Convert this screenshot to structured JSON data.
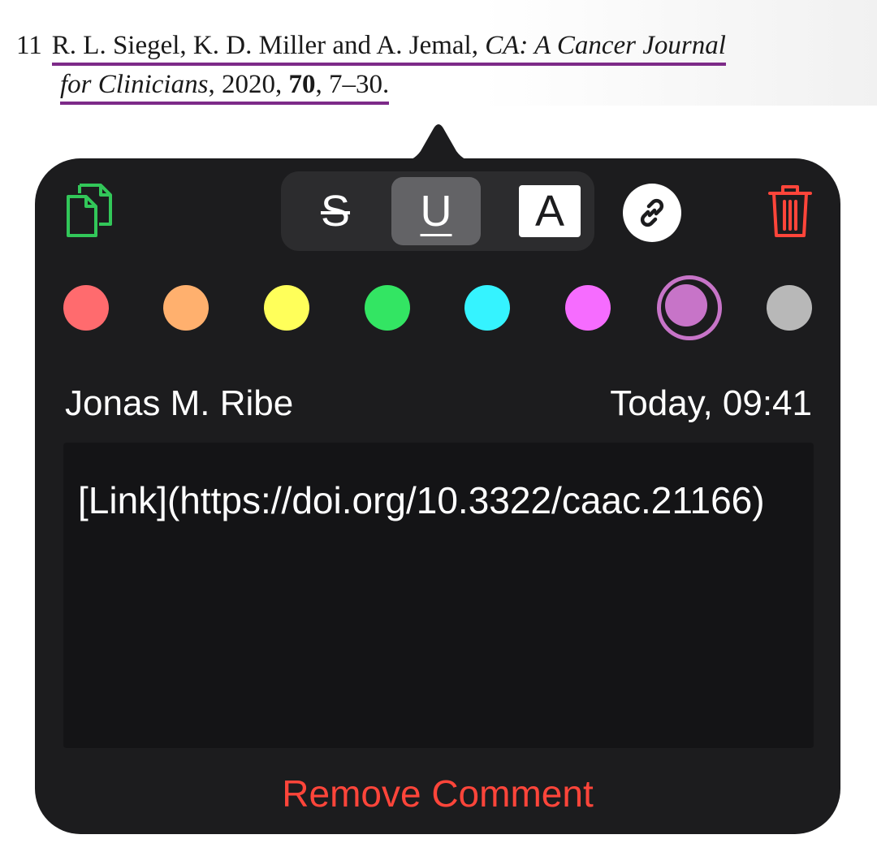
{
  "reference": {
    "number": "11",
    "authors": "R. L. Siegel, K. D. Miller and A. Jemal,",
    "journal_part1": "CA: A Cancer Journal",
    "journal_part2": "for Clinicians",
    "sep1": ", 2020, ",
    "volume": "70",
    "pages": ", 7–30."
  },
  "toolbar": {
    "copy_icon": "copy-icon",
    "strike_label": "S",
    "underline_label": "U",
    "highlight_label": "A",
    "selected_style": "underline",
    "link_icon": "link-icon",
    "trash_icon": "trash-icon"
  },
  "colors": {
    "swatches": [
      "#ff6b6e",
      "#ffb06e",
      "#ffff5a",
      "#33e563",
      "#35f3ff",
      "#f66cff",
      "#c774c8",
      "#b8b8b8"
    ],
    "selected_index": 6,
    "accent_delete": "#ff453a",
    "copy_green": "#32c759",
    "underline_purple": "#7d2a88"
  },
  "comment": {
    "author": "Jonas M. Ribe",
    "timestamp": "Today, 09:41",
    "text": "[Link](https://doi.org/10.3322/caac.21166)"
  },
  "actions": {
    "remove_label": "Remove Comment"
  }
}
